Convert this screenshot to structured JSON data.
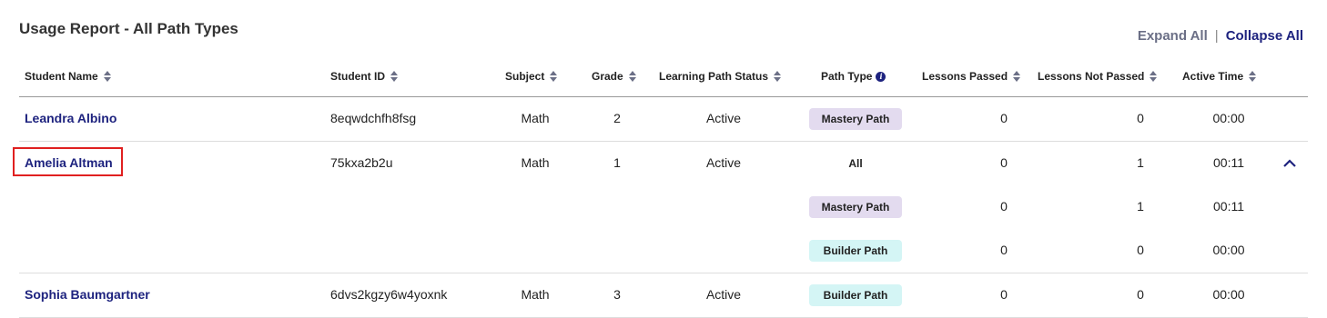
{
  "report": {
    "title": "Usage Report  - All Path Types",
    "expand_all": "Expand All",
    "separator": "|",
    "collapse_all": "Collapse All"
  },
  "columns": {
    "student_name": "Student Name",
    "student_id": "Student ID",
    "subject": "Subject",
    "grade": "Grade",
    "learning_path_status": "Learning Path Status",
    "path_type": "Path Type",
    "lessons_passed": "Lessons Passed",
    "lessons_not_passed": "Lessons Not Passed",
    "active_time": "Active Time"
  },
  "rows": [
    {
      "name": "Leandra Albino",
      "id": "8eqwdchfh8fsg",
      "subject": "Math",
      "grade": "2",
      "status": "Active",
      "path_type": "Mastery Path",
      "passed": "0",
      "not_passed": "0",
      "time": "00:00"
    },
    {
      "name": "Amelia Altman",
      "id": "75kxa2b2u",
      "subject": "Math",
      "grade": "1",
      "status": "Active",
      "path_type": "All",
      "passed": "0",
      "not_passed": "1",
      "time": "00:11",
      "sub": [
        {
          "path_type": "Mastery Path",
          "passed": "0",
          "not_passed": "1",
          "time": "00:11"
        },
        {
          "path_type": "Builder Path",
          "passed": "0",
          "not_passed": "0",
          "time": "00:00"
        }
      ]
    },
    {
      "name": "Sophia Baumgartner",
      "id": "6dvs2kgzy6w4yoxnk",
      "subject": "Math",
      "grade": "3",
      "status": "Active",
      "path_type": "Builder Path",
      "passed": "0",
      "not_passed": "0",
      "time": "00:00"
    }
  ],
  "colors": {
    "accent": "#1e237f",
    "highlight": "#e02020",
    "mastery_bg": "#e3dbef",
    "builder_bg": "#d4f5f5"
  },
  "icons": {
    "sort": "sort-icon",
    "info": "info-icon",
    "chevron": "chevron-up-icon"
  }
}
